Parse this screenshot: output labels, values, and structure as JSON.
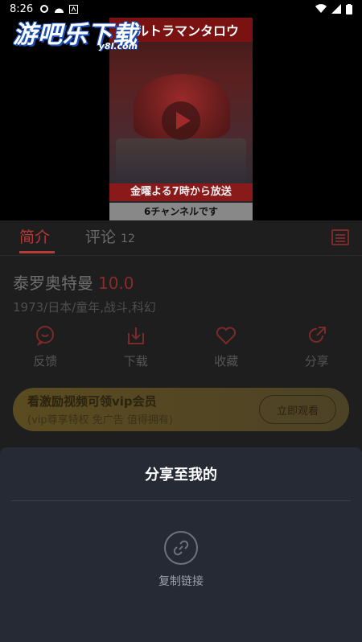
{
  "status_bar": {
    "time": "8:26"
  },
  "watermark": {
    "title": "游吧乐下载",
    "url": "y8l.com"
  },
  "video": {
    "poster_top": "ウルトラマンタロウ",
    "poster_band": "金曜よる7時から放送",
    "poster_bottom": "6チャンネルです"
  },
  "tabs": [
    {
      "label": "简介",
      "active": true
    },
    {
      "label": "评论",
      "count": "12",
      "active": false
    }
  ],
  "movie": {
    "title": "泰罗奥特曼",
    "score": "10.0",
    "meta": "1973/日本/童年,战斗,科幻"
  },
  "actions": [
    {
      "label": "反馈",
      "icon": "feedback-icon"
    },
    {
      "label": "下载",
      "icon": "download-icon"
    },
    {
      "label": "收藏",
      "icon": "heart-icon"
    },
    {
      "label": "分享",
      "icon": "share-icon"
    }
  ],
  "vip_banner": {
    "line1": "看激励视频可领vip会员",
    "line2": "(vip尊享特权 免广告 值得拥有)",
    "button": "立即观看"
  },
  "share_sheet": {
    "title": "分享至我的",
    "items": [
      {
        "label": "复制链接",
        "icon": "link-icon"
      }
    ]
  },
  "colors": {
    "accent": "#b53a3a",
    "sheet_bg": "#252a35",
    "content_bg": "#1e1e1e"
  }
}
